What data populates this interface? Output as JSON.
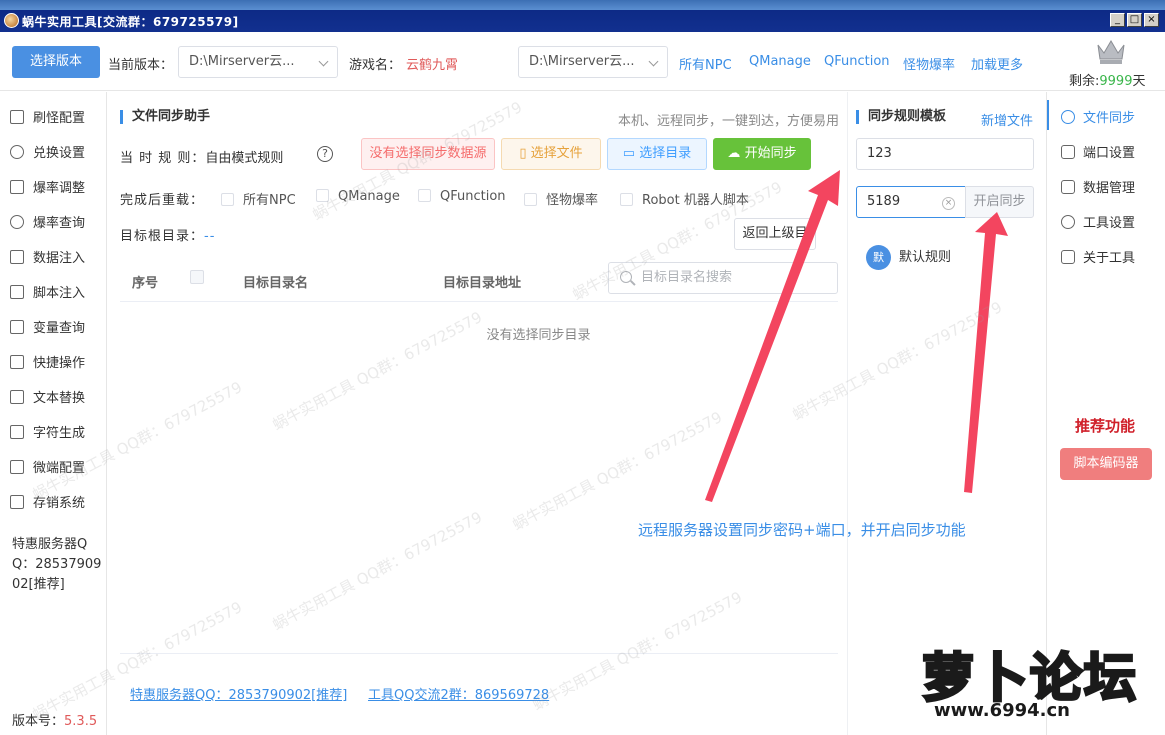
{
  "window": {
    "title": "蜗牛实用工具[交流群：679725579]",
    "buttons": [
      "_",
      "□",
      "×"
    ]
  },
  "toolbar": {
    "select_version_btn": "选择版本",
    "current_version_label": "当前版本：",
    "current_version_value": "D:\\Mirserver云...",
    "game_name_label": "游戏名：",
    "game_name_value": "云鹤九霄",
    "path_select_value": "D:\\Mirserver云...",
    "links": [
      "所有NPC",
      "QManage",
      "QFunction",
      "怪物爆率",
      "加载更多"
    ],
    "remain_label": "剩余:",
    "remain_value": "9999",
    "remain_unit": "天"
  },
  "sidebar": {
    "items": [
      {
        "label": "刷怪配置",
        "icon": "cat-icon"
      },
      {
        "label": "兑换设置",
        "icon": "coin-icon"
      },
      {
        "label": "爆率调整",
        "icon": "box-icon"
      },
      {
        "label": "爆率查询",
        "icon": "search-icon"
      },
      {
        "label": "数据注入",
        "icon": "grid-icon"
      },
      {
        "label": "脚本注入",
        "icon": "script-icon"
      },
      {
        "label": "变量查询",
        "icon": "variable-icon"
      },
      {
        "label": "快捷操作",
        "icon": "folder-icon"
      },
      {
        "label": "文本替换",
        "icon": "text-icon"
      },
      {
        "label": "字符生成",
        "icon": "lock-icon"
      },
      {
        "label": "微端配置",
        "icon": "flask-icon"
      },
      {
        "label": "存销系统",
        "icon": "store-icon"
      }
    ],
    "promo": "特惠服务器QQ：2853790902[推荐]",
    "version_label": "版本号：",
    "version_value": "5.3.5"
  },
  "main": {
    "title": "文件同步助手",
    "hint": "本机、远程同步，一键到达，方便易用",
    "rule_label": "当 时 规 则：",
    "rule_value": "自由模式规则",
    "help": "?",
    "btn_no_source": "没有选择同步数据源",
    "btn_select_file": "选择文件",
    "btn_select_dir": "选择目录",
    "btn_start_sync": "开始同步",
    "reload_label": "完成后重载：",
    "reload_options": [
      "所有NPC",
      "QManage",
      "QFunction",
      "怪物爆率",
      "Robot 机器人脚本"
    ],
    "root_label": "目标根目录：",
    "root_value": "--",
    "btn_back": "返回上级目",
    "table": {
      "col_index": "序号",
      "col_name": "目标目录名",
      "col_path": "目标目录地址",
      "search_placeholder": "目标目录名搜索",
      "empty": "没有选择同步目录"
    },
    "footer_link1": "特惠服务器QQ：2853790902[推荐]",
    "footer_link2": "工具QQ交流2群：869569728"
  },
  "template_panel": {
    "title": "同步规则模板",
    "new_file": "新增文件",
    "password_value": "123",
    "port_value": "5189",
    "enable_sync_btn": "开启同步",
    "rule_badge": "默",
    "rule_name": "默认规则"
  },
  "rightnav": {
    "items": [
      {
        "label": "文件同步",
        "icon": "cloud-upload-icon",
        "active": true
      },
      {
        "label": "端口设置",
        "icon": "port-icon",
        "active": false
      },
      {
        "label": "数据管理",
        "icon": "cube-icon",
        "active": false
      },
      {
        "label": "工具设置",
        "icon": "gear-icon",
        "active": false
      },
      {
        "label": "关于工具",
        "icon": "document-icon",
        "active": false
      }
    ],
    "recommend_title": "推荐功能",
    "encoder_btn": "脚本编码器"
  },
  "annotation": "远程服务器设置同步密码+端口，并开启同步功能",
  "logo": {
    "text": "萝卜论坛",
    "url": "www.6994.cn"
  },
  "watermark": "蜗牛实用工具 QQ群：679725579",
  "colors": {
    "accent": "#3a8ee6",
    "primary_btn": "#4a90e2",
    "success": "#67c23a",
    "danger_text": "#f56c6c",
    "arrow": "#f3455f",
    "title_bar": "#0d2a86"
  }
}
